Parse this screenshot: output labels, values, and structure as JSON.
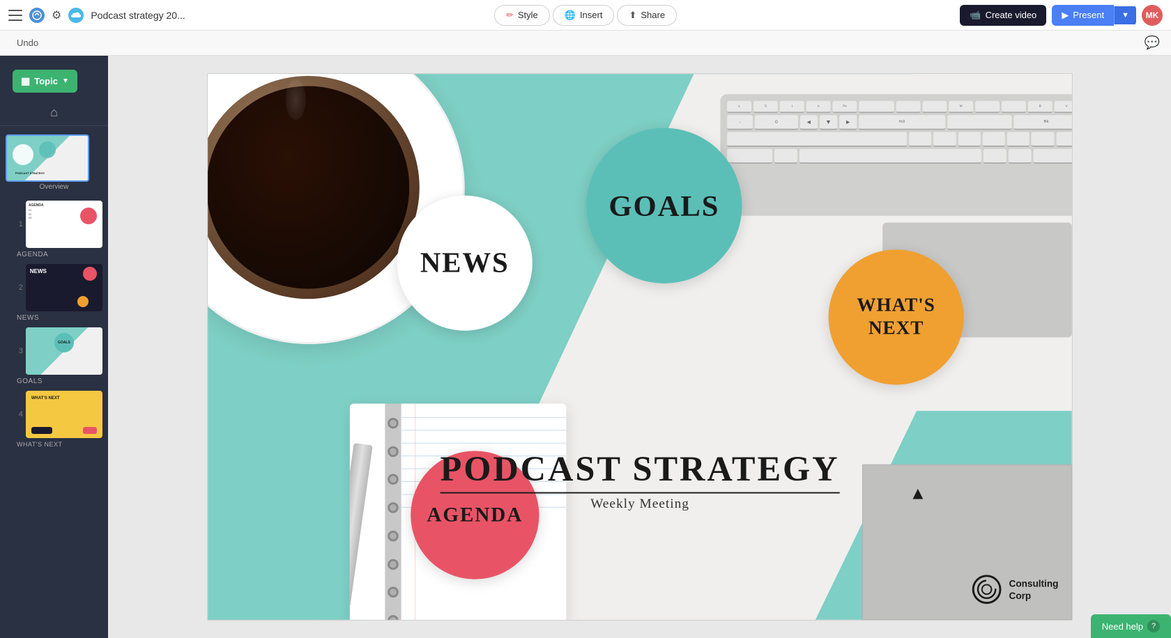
{
  "topbar": {
    "doc_title": "Podcast strategy 20...",
    "style_label": "Style",
    "insert_label": "Insert",
    "share_label": "Share",
    "create_video_label": "Create video",
    "present_label": "Present",
    "avatar_initials": "MK"
  },
  "secondbar": {
    "undo_label": "Undo"
  },
  "sidebar": {
    "topic_label": "Topic",
    "overview_label": "Overview",
    "slides": [
      {
        "number": "1",
        "label": "AGENDA"
      },
      {
        "number": "2",
        "label": "NEWS"
      },
      {
        "number": "3",
        "label": "GOALS"
      },
      {
        "number": "4",
        "label": "WHAT'S NEXT"
      }
    ]
  },
  "slide": {
    "circle_news": "NEWS",
    "circle_goals": "GOALS",
    "circle_whats_next": "WHAT'S\nNEXT",
    "circle_agenda": "AGENDA",
    "main_title": "PODCAST STRATEGY",
    "main_subtitle": "Weekly Meeting",
    "logo_text": "Consulting\nCorp"
  },
  "need_help_label": "Need help",
  "colors": {
    "teal": "#7ecfc5",
    "green_btn": "#3cb371",
    "blue_btn": "#4a7ff5",
    "news_circle": "#ffffff",
    "goals_circle": "#5bbfb8",
    "whats_next_circle": "#f0a030",
    "agenda_circle": "#e85466"
  }
}
